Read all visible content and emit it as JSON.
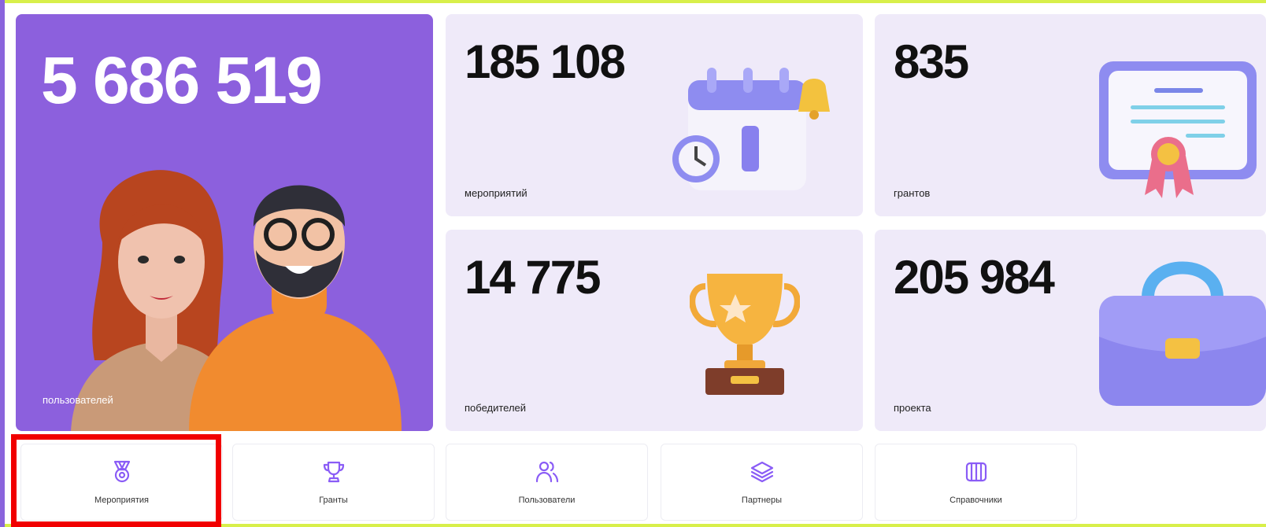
{
  "stats": {
    "users": {
      "value": "5 686 519",
      "label": "пользователей"
    },
    "events": {
      "value": "185 108",
      "label": "мероприятий"
    },
    "grants": {
      "value": "835",
      "label": "грантов"
    },
    "winners": {
      "value": "14 775",
      "label": "победителей"
    },
    "projects": {
      "value": "205 984",
      "label": "проекта"
    }
  },
  "nav": {
    "tiles": [
      {
        "label": "Мероприятия",
        "icon": "medal-icon"
      },
      {
        "label": "Гранты",
        "icon": "trophy-icon"
      },
      {
        "label": "Пользователи",
        "icon": "users-icon"
      },
      {
        "label": "Партнеры",
        "icon": "layers-icon"
      },
      {
        "label": "Справочники",
        "icon": "columns-icon"
      }
    ],
    "selected": "Мероприятия"
  },
  "colors": {
    "hero_bg": "#8c60dd",
    "stat_bg": "#efeaf9",
    "accent": "#8a5cf6",
    "highlight": "#f10000",
    "frame": "#d8ef4a"
  }
}
